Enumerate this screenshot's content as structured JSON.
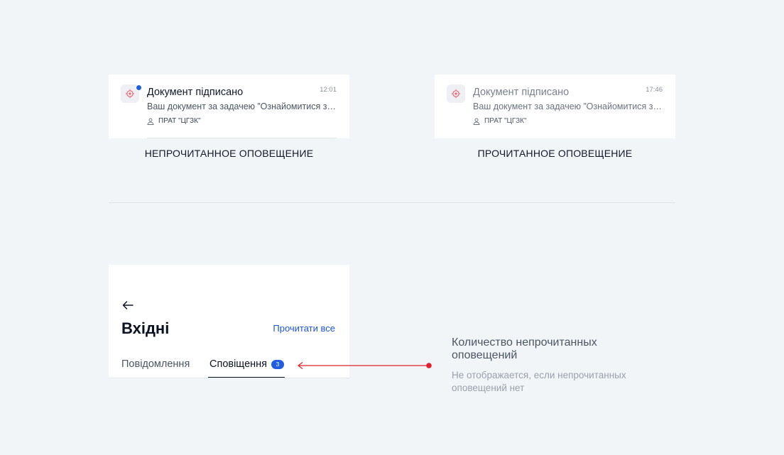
{
  "notifications": {
    "unread": {
      "title": "Документ підписано",
      "time": "12:01",
      "body": "Ваш документ за задачею ”Ознайомитися з документом”",
      "org": "ПРАТ \"ЦГЗК\"",
      "caption": "НЕПРОЧИТАННОЕ ОПОВЕЩЕНИЕ"
    },
    "read": {
      "title": "Документ підписано",
      "time": "17:46",
      "body": "Ваш документ за задачею ”Ознайомитися з документом”",
      "org": "ПРАТ \"ЦГЗК\"",
      "caption": "ПРОЧИТАННОЕ ОПОВЕЩЕНИЕ"
    }
  },
  "inbox": {
    "title": "Вхідні",
    "read_all": "Прочитати все",
    "tabs": [
      {
        "label": "Повідомлення"
      },
      {
        "label": "Сповіщення",
        "badge": "3"
      }
    ]
  },
  "annotation": {
    "title": "Количество непрочитанных оповещений",
    "subtitle": "Не отображается, если непрочитанных оповещений нет"
  },
  "colors": {
    "background": "#f2f5f8",
    "accent": "#1f5ee0",
    "link": "#1a56db",
    "pointer": "#e0202a"
  },
  "icons": [
    "company-logo-icon",
    "unread-dot-icon",
    "user-icon",
    "back-arrow-icon"
  ]
}
